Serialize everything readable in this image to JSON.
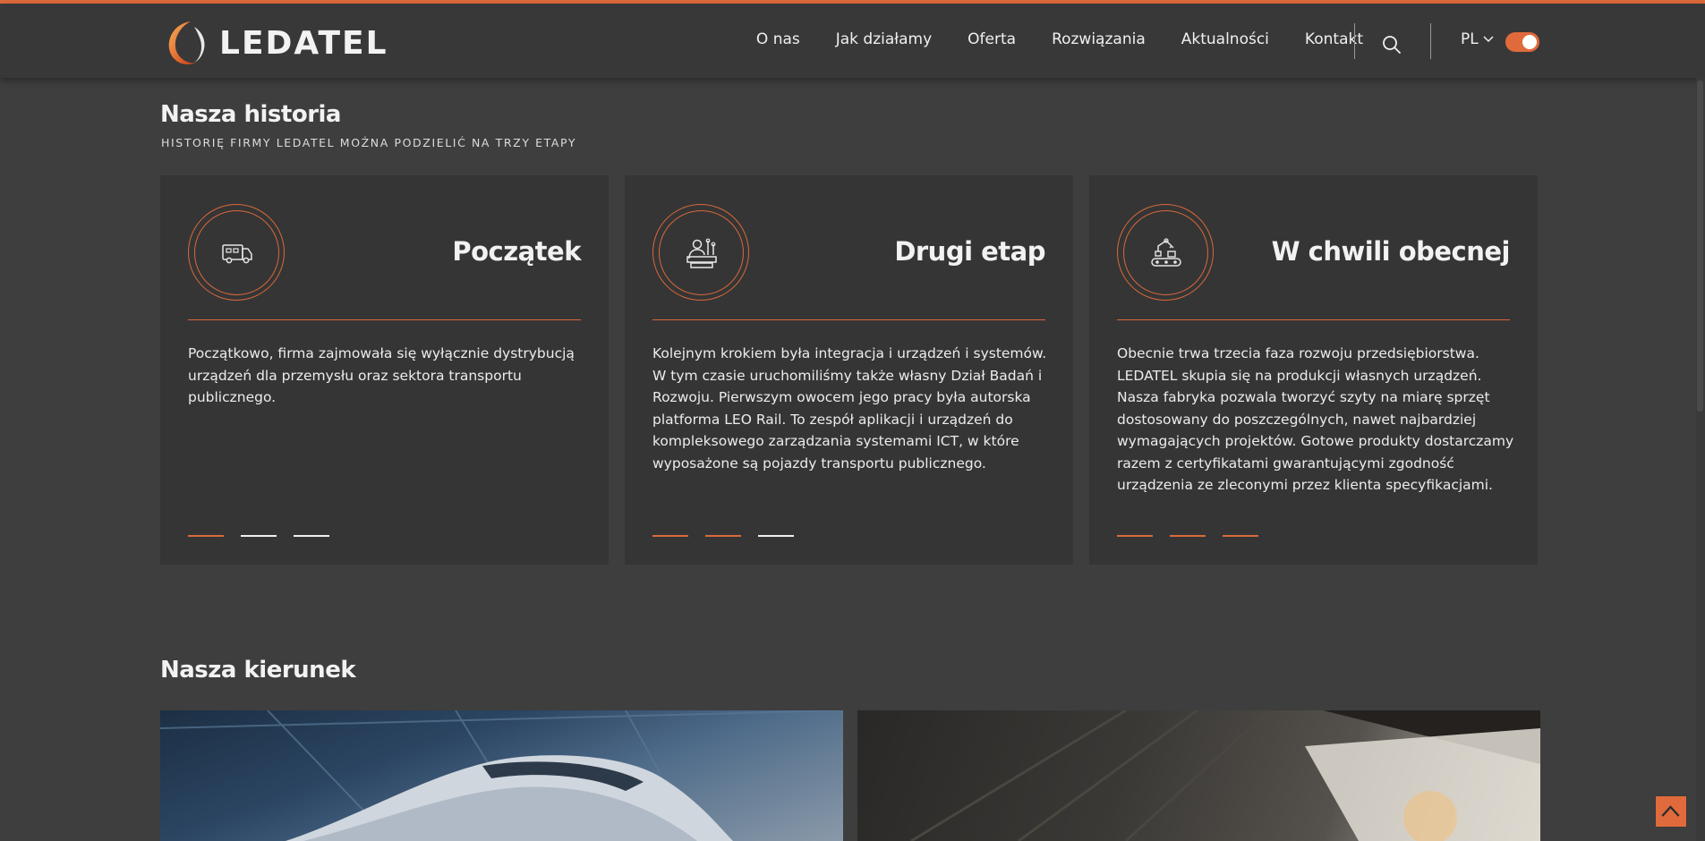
{
  "brand": {
    "name": "LEDATEL",
    "accent": "#e06a3c"
  },
  "nav": {
    "items": [
      "O nas",
      "Jak działamy",
      "Oferta",
      "Rozwiązania",
      "Aktualności",
      "Kontakt"
    ],
    "search_icon": "search-icon",
    "language": "PL"
  },
  "history": {
    "title": "Nasza historia",
    "subtitle": "HISTORIĘ FIRMY LEDATEL MOŻNA PODZIELIĆ NA TRZY ETAPY",
    "cards": [
      {
        "title": "Początek",
        "icon": "delivery-van-icon",
        "text": "Początkowo, firma zajmowała się wyłącznie dystrybucją urządzeń dla przemysłu oraz sektora transportu publicznego.",
        "active_step": 1
      },
      {
        "title": "Drugi etap",
        "icon": "engineer-icon",
        "text": "Kolejnym krokiem była integracja i urządzeń i systemów. W tym czasie uruchomiliśmy także własny Dział Badań i Rozwoju. Pierwszym owocem jego pracy była autorska platforma LEO Rail. To zespół aplikacji i urządzeń do kompleksowego zarządzania systemami ICT, w które wyposażone są pojazdy transportu publicznego.",
        "active_step": 2
      },
      {
        "title": "W chwili obecnej",
        "icon": "robot-arm-icon",
        "text": "Obecnie trwa trzecia faza rozwoju przedsiębiorstwa. LEDATEL skupia się na produkcji własnych urządzeń. Nasza fabryka pozwala tworzyć szyty na miarę sprzęt dostosowany do poszczególnych, nawet najbardziej wymagających projektów. Gotowe produkty dostarczamy razem z certyfikatami gwarantującymi zgodność urządzenia ze zleconymi przez klienta specyfikacjami.",
        "active_step": 3
      }
    ]
  },
  "direction": {
    "title": "Nasza kierunek"
  }
}
